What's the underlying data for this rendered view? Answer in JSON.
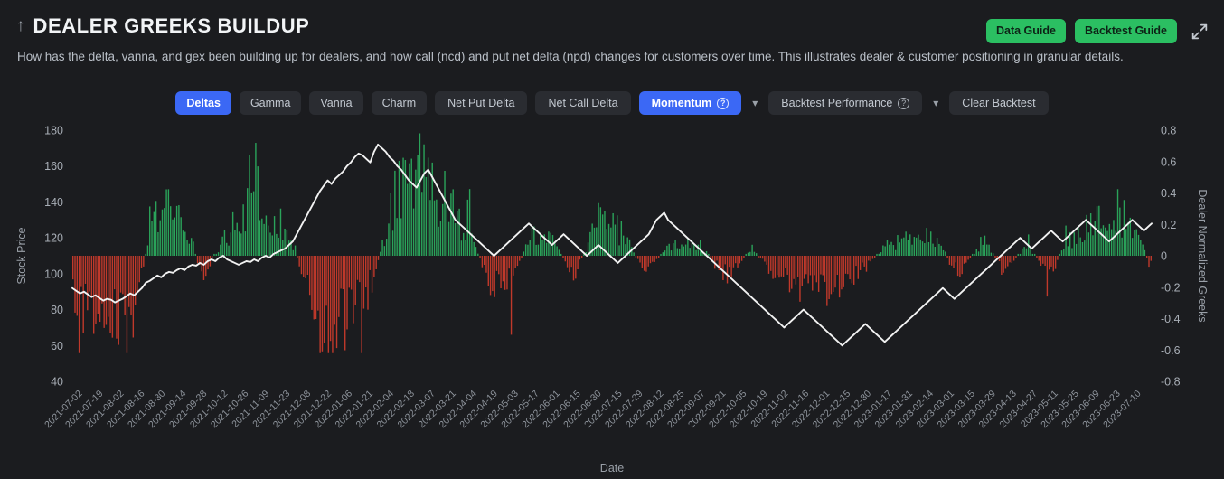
{
  "header": {
    "up_icon": "arrow-up-icon",
    "title": "DEALER GREEKS BUILDUP",
    "subtitle": "How has the delta, vanna, and gex been building up for dealers, and how call (ncd) and put net delta (npd) changes for customers over time. This illustrates dealer & customer positioning in granular details.",
    "data_guide_label": "Data Guide",
    "backtest_guide_label": "Backtest Guide",
    "expand_icon": "expand-diagonal-icon",
    "accent_green": "#2bbf62"
  },
  "toolbar": {
    "buttons": [
      {
        "label": "Deltas",
        "active": true
      },
      {
        "label": "Gamma",
        "active": false
      },
      {
        "label": "Vanna",
        "active": false
      },
      {
        "label": "Charm",
        "active": false
      },
      {
        "label": "Net Put Delta",
        "active": false
      },
      {
        "label": "Net Call Delta",
        "active": false
      }
    ],
    "momentum_label": "Momentum",
    "backtest_perf_label": "Backtest Performance",
    "clear_backtest_label": "Clear Backtest",
    "active_color": "#3b68f5"
  },
  "chart_data": {
    "type": "bar",
    "title": "",
    "xlabel": "Date",
    "ylabel": "Stock Price",
    "y2label": "Dealer Normalized Greeks",
    "ylim": [
      40,
      180
    ],
    "y2lim": [
      -0.8,
      0.8
    ],
    "yticks": [
      180,
      160,
      140,
      120,
      100,
      80,
      60,
      40
    ],
    "y2ticks": [
      0.8,
      0.6,
      0.4,
      0.2,
      0,
      -0.2,
      -0.4,
      -0.6,
      -0.8
    ],
    "grid": false,
    "legend": "none",
    "bar_positive_color": "#2aa35a",
    "bar_negative_color": "#c0392b",
    "line_color": "#f2f2f2",
    "background": "#17181b",
    "xticks": [
      "2021-07-02",
      "2021-07-19",
      "2021-08-02",
      "2021-08-16",
      "2021-08-30",
      "2021-09-14",
      "2021-09-28",
      "2021-10-12",
      "2021-10-26",
      "2021-11-09",
      "2021-11-23",
      "2021-12-08",
      "2021-12-22",
      "2022-01-06",
      "2022-01-21",
      "2022-02-04",
      "2022-02-18",
      "2022-03-07",
      "2022-03-21",
      "2022-04-04",
      "2022-04-19",
      "2022-05-03",
      "2022-05-17",
      "2022-06-01",
      "2022-06-15",
      "2022-06-30",
      "2022-07-15",
      "2022-07-29",
      "2022-08-12",
      "2022-08-25",
      "2022-09-07",
      "2022-09-21",
      "2022-10-05",
      "2022-10-19",
      "2022-11-02",
      "2022-11-16",
      "2022-12-01",
      "2022-12-15",
      "2022-12-30",
      "2023-01-17",
      "2023-01-31",
      "2023-02-14",
      "2023-03-01",
      "2023-03-15",
      "2023-03-29",
      "2023-04-13",
      "2023-04-27",
      "2023-05-11",
      "2023-05-25",
      "2023-06-09",
      "2023-06-23",
      "2023-07-10"
    ],
    "series": [
      {
        "name": "Stock Price",
        "axis": "left",
        "type": "line",
        "values": [
          92,
          90.5,
          89,
          90,
          88.5,
          87,
          88,
          86.5,
          85,
          86,
          85.5,
          84,
          85,
          86,
          87.5,
          89,
          88,
          90,
          92,
          95,
          96,
          97.5,
          99,
          98,
          100,
          101,
          100.5,
          102,
          103,
          102,
          104,
          105,
          104.5,
          106,
          105,
          107,
          108,
          107,
          109,
          110,
          108,
          107,
          106,
          105,
          106,
          107,
          106.5,
          108,
          107,
          109,
          110,
          109,
          111,
          112,
          113,
          114,
          116,
          118,
          122,
          126,
          130,
          134,
          138,
          142,
          146,
          149,
          152,
          150,
          153,
          155,
          157,
          160,
          162,
          165,
          167,
          166,
          164,
          162,
          168,
          172,
          170,
          168,
          165,
          163,
          160,
          158,
          155,
          152,
          150,
          148,
          152,
          156,
          158,
          154,
          150,
          146,
          142,
          138,
          134,
          130,
          128,
          126,
          124,
          122,
          120,
          118,
          116,
          114,
          112,
          110,
          112,
          114,
          116,
          118,
          120,
          122,
          124,
          126,
          128,
          126,
          124,
          122,
          120,
          118,
          116,
          118,
          120,
          122,
          120,
          118,
          116,
          114,
          112,
          110,
          112,
          114,
          116,
          114,
          112,
          110,
          108,
          106,
          108,
          110,
          112,
          114,
          116,
          118,
          120,
          122,
          126,
          130,
          132,
          134,
          130,
          128,
          126,
          124,
          122,
          120,
          118,
          116,
          114,
          112,
          110,
          108,
          106,
          104,
          102,
          100,
          98,
          96,
          94,
          92,
          90,
          88,
          86,
          84,
          82,
          80,
          78,
          76,
          74,
          72,
          70,
          72,
          74,
          76,
          78,
          80,
          78,
          76,
          74,
          72,
          70,
          68,
          66,
          64,
          62,
          60,
          62,
          64,
          66,
          68,
          70,
          72,
          70,
          68,
          66,
          64,
          62,
          64,
          66,
          68,
          70,
          72,
          74,
          76,
          78,
          80,
          82,
          84,
          86,
          88,
          90,
          92,
          90,
          88,
          86,
          88,
          90,
          92,
          94,
          96,
          98,
          100,
          102,
          104,
          106,
          108,
          110,
          112,
          114,
          116,
          118,
          120,
          118,
          116,
          114,
          116,
          118,
          120,
          122,
          124,
          122,
          120,
          118,
          120,
          122,
          124,
          126,
          128,
          130,
          128,
          126,
          124,
          122,
          120,
          118,
          120,
          122,
          124,
          126,
          128,
          130,
          128,
          126,
          124,
          126,
          128
        ]
      },
      {
        "name": "Dealer Normalized Greeks",
        "axis": "right",
        "type": "bar",
        "note": "positive (green) / negative (red) daily dealer normalized greek values, approx range -0.6 to 0.75"
      }
    ]
  }
}
